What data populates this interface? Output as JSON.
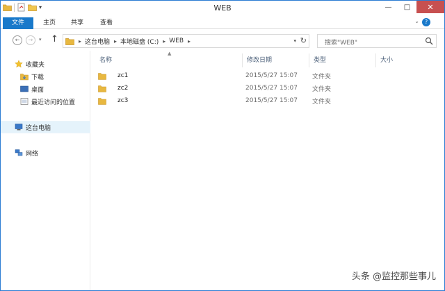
{
  "window": {
    "title": "WEB"
  },
  "ribbon": {
    "tabs": [
      "文件",
      "主页",
      "共享",
      "查看"
    ],
    "help": "?"
  },
  "titlebar": {
    "minimize": "—",
    "maximize": "□",
    "close": "✕"
  },
  "address": {
    "crumbs": [
      "这台电脑",
      "本地磁盘 (C:)",
      "WEB"
    ]
  },
  "search": {
    "placeholder": "搜索\"WEB\""
  },
  "navpane": {
    "favorites": "收藏夹",
    "downloads": "下载",
    "desktop": "桌面",
    "recent": "最近访问的位置",
    "thispc": "这台电脑",
    "network": "网络"
  },
  "columns": {
    "name": "名称",
    "modified": "修改日期",
    "type": "类型",
    "size": "大小"
  },
  "files": [
    {
      "name": "zc1",
      "modified": "2015/5/27 15:07",
      "type": "文件夹"
    },
    {
      "name": "zc2",
      "modified": "2015/5/27 15:07",
      "type": "文件夹"
    },
    {
      "name": "zc3",
      "modified": "2015/5/27 15:07",
      "type": "文件夹"
    }
  ],
  "watermark": "头条 @监控那些事儿",
  "colors": {
    "accent": "#1979ca",
    "folder": "#e8b840",
    "selected": "#e5f3fb",
    "close": "#c75050"
  }
}
